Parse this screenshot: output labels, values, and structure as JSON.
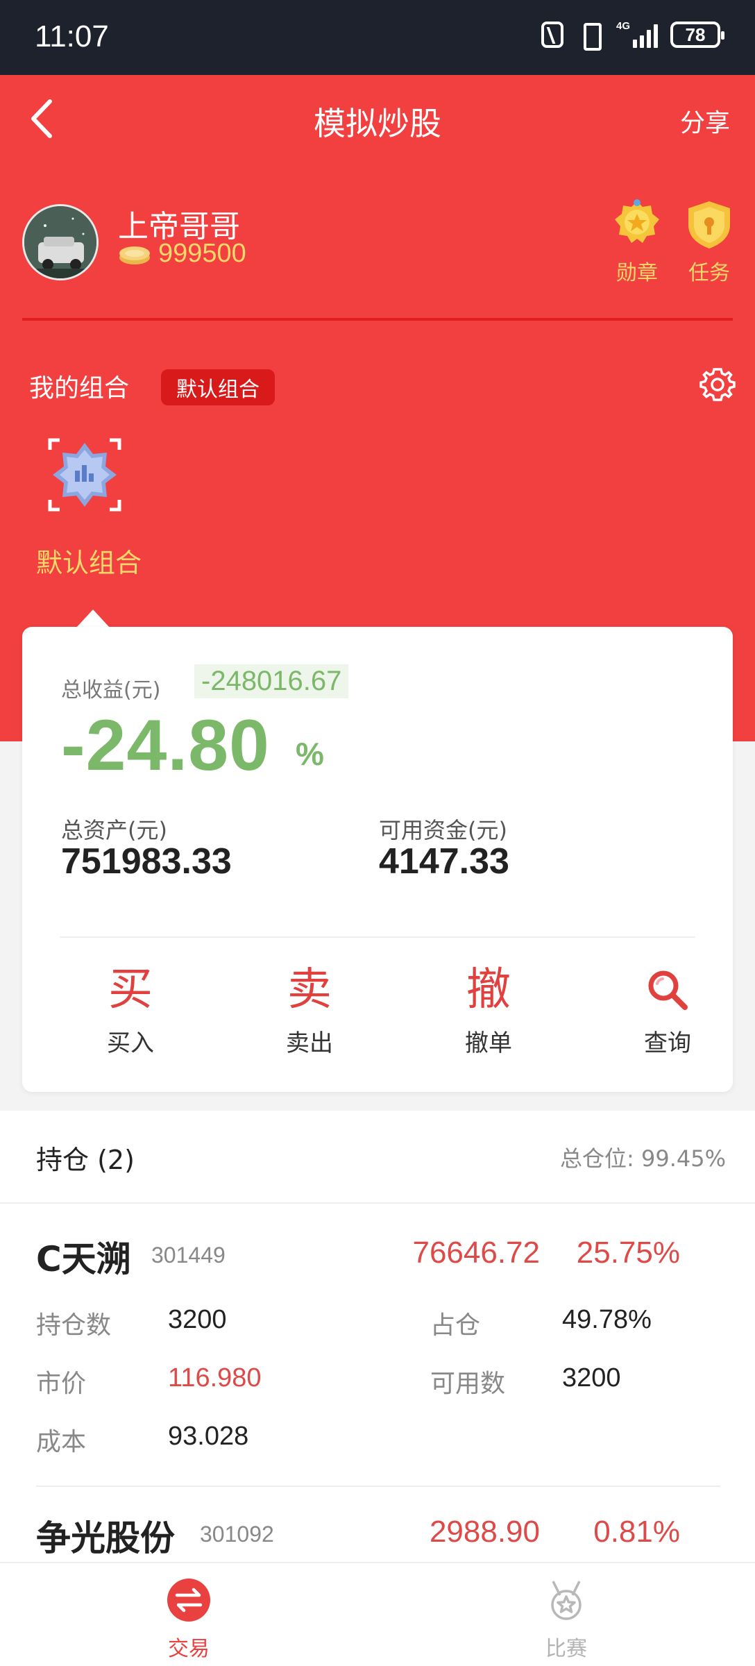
{
  "status_bar": {
    "time": "11:07",
    "network": "4G",
    "battery": "78"
  },
  "nav": {
    "title": "模拟炒股",
    "share": "分享"
  },
  "profile": {
    "username": "上帝哥哥",
    "coins": "999500",
    "medal_label": "勋章",
    "task_label": "任务"
  },
  "portfolio": {
    "section_label": "我的组合",
    "badge": "默认组合",
    "item_label": "默认组合"
  },
  "summary": {
    "total_profit_label": "总收益(元)",
    "total_profit_value": "-248016.67",
    "return_pct": "-24.80",
    "pct_sign": "%",
    "total_assets_label": "总资产(元)",
    "total_assets_value": "751983.33",
    "available_funds_label": "可用资金(元)",
    "available_funds_value": "4147.33"
  },
  "actions": [
    {
      "glyph": "买",
      "label": "买入"
    },
    {
      "glyph": "卖",
      "label": "卖出"
    },
    {
      "glyph": "撤",
      "label": "撤单"
    },
    {
      "glyph": "search-icon",
      "label": "查询"
    }
  ],
  "holdings": {
    "title": "持仓 (2)",
    "position_ratio": "总仓位: 99.45%",
    "stocks": [
      {
        "name": "C天溯",
        "code": "301449",
        "market_value": "76646.72",
        "pct": "25.75%",
        "shares_label": "持仓数",
        "shares": "3200",
        "weight_label": "占仓",
        "weight": "49.78%",
        "price_label": "市价",
        "price": "116.980",
        "available_label": "可用数",
        "available": "3200",
        "cost_label": "成本",
        "cost": "93.028"
      },
      {
        "name": "争光股份",
        "code": "301092",
        "market_value": "2988.90",
        "pct": "0.81%"
      }
    ]
  },
  "tabbar": {
    "trade": "交易",
    "contest": "比赛"
  },
  "colors": {
    "brand_red": "#f23f3f",
    "loss_green": "#7bb86a",
    "gain_red": "#dd4a48",
    "gold": "#f8d86a"
  }
}
